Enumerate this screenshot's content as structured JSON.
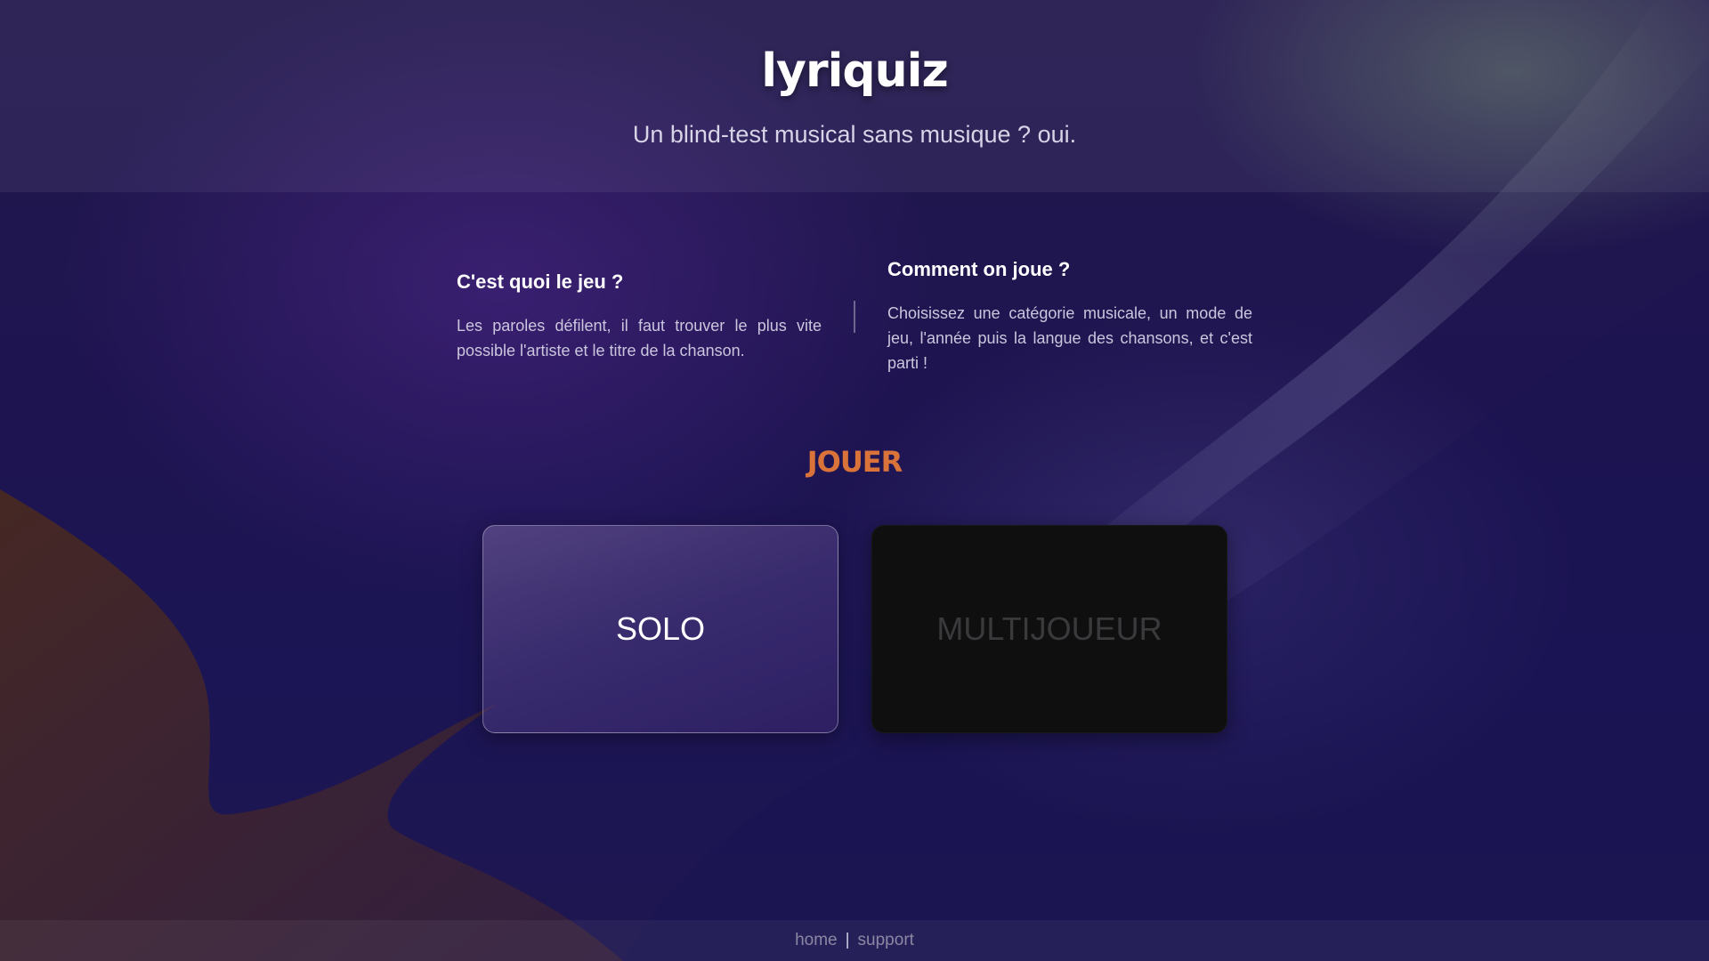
{
  "header": {
    "logo": "lyriquiz",
    "tagline": "Un blind-test musical sans musique ? oui."
  },
  "info": {
    "left": {
      "title": "C'est quoi le jeu ?",
      "text": "Les paroles défilent, il faut trouver le plus vite possible l'artiste et le titre de la chanson."
    },
    "right": {
      "title": "Comment on joue ?",
      "text": "Choisissez une catégorie musicale, un mode de jeu, l'année puis la langue des chansons, et c'est parti !"
    }
  },
  "play": {
    "title": "JOUER",
    "solo_label": "SOLO",
    "multi_label": "MULTIJOUEUR"
  },
  "footer": {
    "home": "home",
    "separator": "|",
    "support": "support"
  },
  "colors": {
    "accent": "#d9733a",
    "background": "#1e1450"
  }
}
